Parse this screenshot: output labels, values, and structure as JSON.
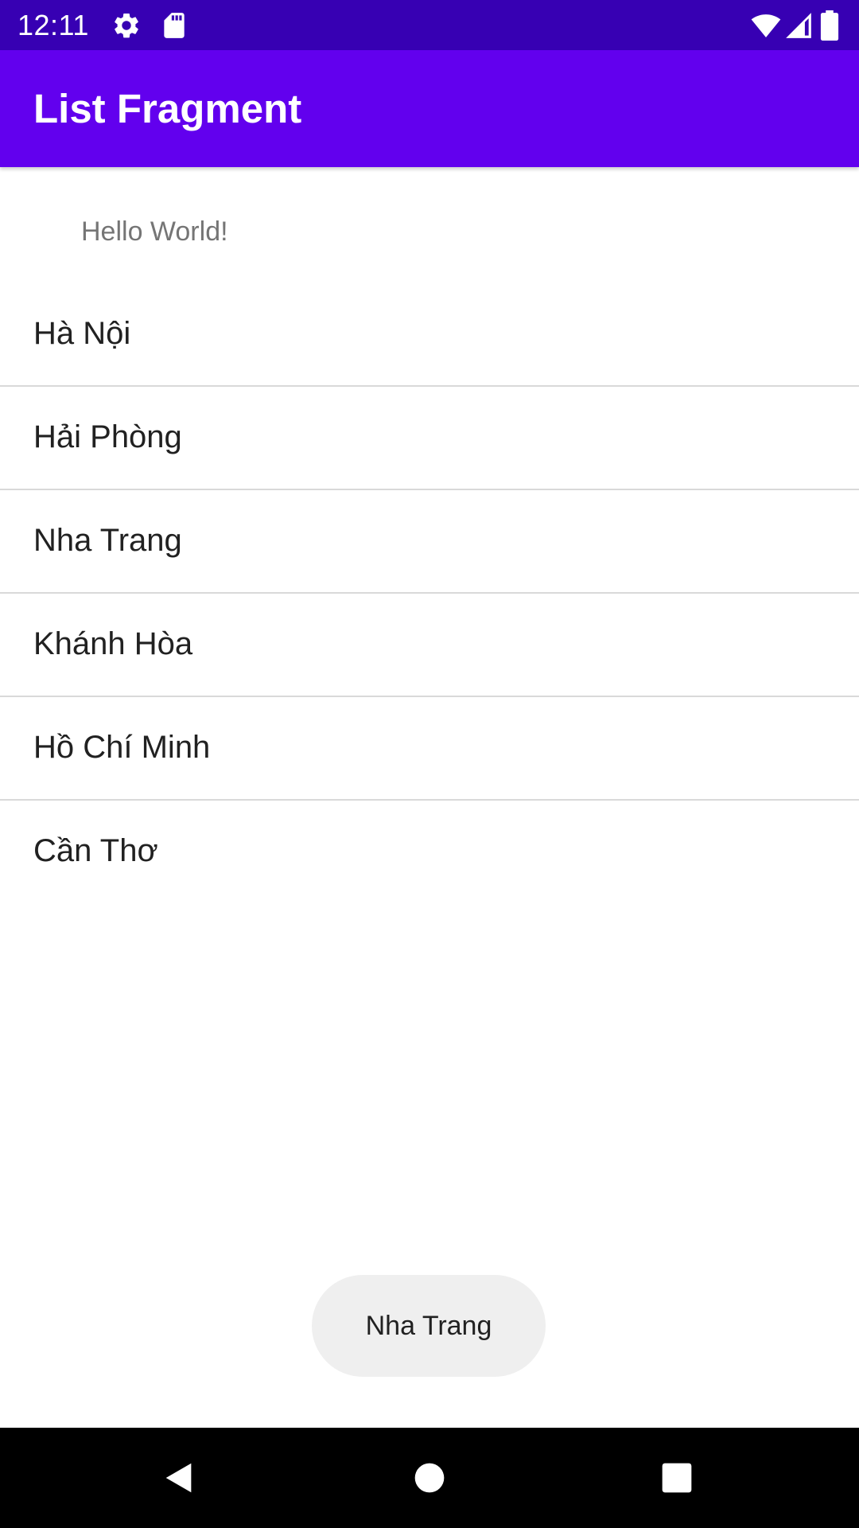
{
  "status_bar": {
    "time": "12:11",
    "icons": [
      "settings-icon",
      "sd-card-icon",
      "wifi-icon",
      "signal-icon",
      "battery-icon"
    ],
    "background_color": "#3700b3"
  },
  "app_bar": {
    "title": "List Fragment",
    "background_color": "#6200ee"
  },
  "content": {
    "hello_text": "Hello World!"
  },
  "list": {
    "items": [
      {
        "label": "Hà Nội"
      },
      {
        "label": "Hải Phòng"
      },
      {
        "label": "Nha Trang"
      },
      {
        "label": "Khánh Hòa"
      },
      {
        "label": "Hồ Chí Minh"
      },
      {
        "label": "Cần Thơ"
      }
    ]
  },
  "toast": {
    "message": "Nha Trang"
  },
  "nav_bar": {
    "buttons": [
      "back-icon",
      "home-icon",
      "recents-icon"
    ]
  }
}
